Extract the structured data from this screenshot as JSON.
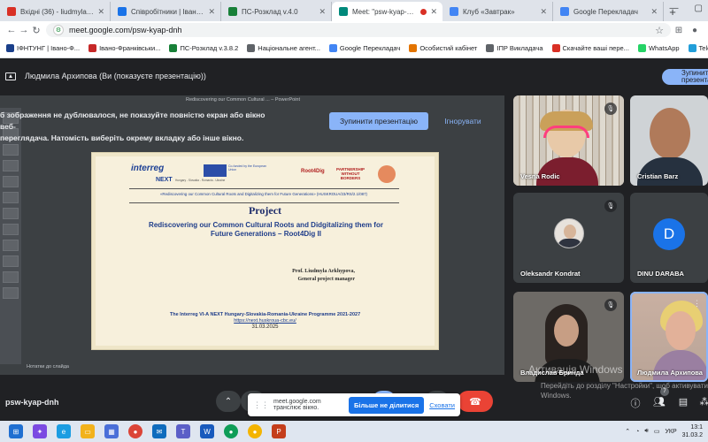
{
  "browser": {
    "tabs": [
      {
        "title": "Вхідні (36) - liudmyla.arkhyp",
        "favicon_color": "#d93025",
        "active": false,
        "recording": false
      },
      {
        "title": "Співробітники | Івано-Франк",
        "favicon_color": "#1a73e8",
        "active": false,
        "recording": false
      },
      {
        "title": "ПС-Розклад v.4.0",
        "favicon_color": "#188038",
        "active": false,
        "recording": false
      },
      {
        "title": "Meet: \"psw-kyap-dnh\"",
        "favicon_color": "#00897b",
        "active": true,
        "recording": true
      },
      {
        "title": "Клуб «Завтрак»",
        "favicon_color": "#4285f4",
        "active": false,
        "recording": false
      },
      {
        "title": "Google Перекладач",
        "favicon_color": "#4285f4",
        "active": false,
        "recording": false
      }
    ],
    "url": "meet.google.com/psw-kyap-dnh",
    "bookmarks": [
      {
        "label": "ІФНТУНГ | Івано-Ф...",
        "color": "#1a3f8a"
      },
      {
        "label": "Івано-Франківськи...",
        "color": "#c62828"
      },
      {
        "label": "ПС-Розклад v.3.8.2",
        "color": "#188038"
      },
      {
        "label": "Національне агент...",
        "color": "#5f6368"
      },
      {
        "label": "Google Перекладач",
        "color": "#4285f4"
      },
      {
        "label": "Особистий кабінет",
        "color": "#e37400"
      },
      {
        "label": "ІПР Викладача",
        "color": "#5f6368"
      },
      {
        "label": "Скачайте ваші пере...",
        "color": "#d93025"
      },
      {
        "label": "WhatsApp",
        "color": "#25d366"
      },
      {
        "label": "Telegram",
        "color": "#229ed9"
      }
    ]
  },
  "meet": {
    "presenter_label": "Людмила Архипова (Ви (показуєте презентацію))",
    "stop_top_label": "Зупинити презента",
    "warning_text": "б зображення не дублювалося, не показуйте повністю екран або вікно веб-\nпереглядача. Натомість виберіть окрему вкладку або інше вікно.",
    "stop_button": "Зупинити презентацію",
    "ignore_button": "Ігнорувати",
    "ppt_window_title": "Rediscovering our Common Cultural ... – PowerPoint",
    "ppt_notes": "Нотатки до слайда",
    "slide": {
      "interreg": "interreg",
      "eu_text": "Co-funded by the European Union",
      "next": "NEXT",
      "next_sub": "Hungary - Slovakia - Romania - Ukraine",
      "root4dig": "Root4Dig",
      "pwb": "PARTNERSHIP WITHOUT BORDERS",
      "subtitle": "«Rediscovering our Common Cultural Roots and Digitalizing them for Future Generations» (HUSKROUA/23/RS/2.1/087)",
      "project": "Project",
      "title": "Rediscovering our Common Cultural Roots and Didgitalizing them for Future Generations – Root4Dig II",
      "prof": "Prof. Liudmyla Arkhypova,",
      "role": "General project manager",
      "programme": "The Interreg VI-A NEXT Hungary-Slovakia-Romania-Ukraine Programme 2021-2027",
      "link": "https://next.huskroua-cbc.eu/",
      "date": "31.03.2025"
    },
    "participants": [
      {
        "name": "Vesna Rodic",
        "muted": true
      },
      {
        "name": "Cristian Barz",
        "muted": false
      },
      {
        "name": "Oleksandr Kondrat",
        "muted": true
      },
      {
        "name": "DINU DARABA",
        "muted": false,
        "initial": "D"
      },
      {
        "name": "Владислав Бринда",
        "muted": true
      },
      {
        "name": "Людмила Архипова",
        "muted": false
      }
    ],
    "meeting_code": "psw-kyap-dnh",
    "notice_text": "meet.google.com транслює вікно.",
    "notice_stop": "Більше не ділитися",
    "notice_hide": "Сховати",
    "people_count": "7",
    "activate_title": "Активація Windows",
    "activate_sub": "Перейдіть до розділу \"Настройки\", щоб активувати Windows."
  },
  "taskbar": {
    "lang": "УКР",
    "time": "13:1",
    "date": "31.03.2"
  },
  "icons": {
    "mic": "microphone-icon",
    "cam": "camera-icon",
    "present": "present-icon",
    "end": "end-call-icon"
  }
}
